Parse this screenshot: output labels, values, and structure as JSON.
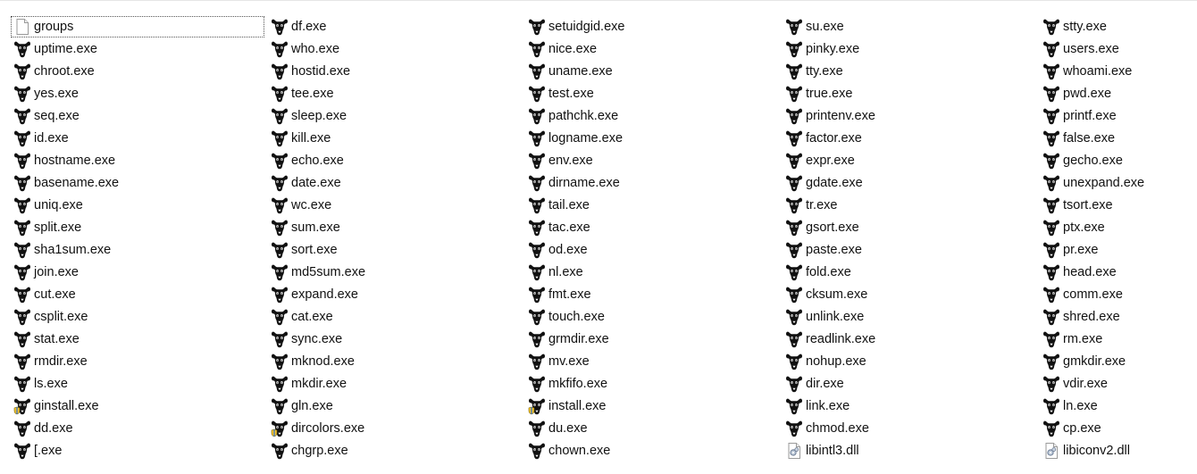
{
  "columns": [
    {
      "items": [
        {
          "name": "groups",
          "icon": "blank-file-icon",
          "focused": true
        },
        {
          "name": "uptime.exe",
          "icon": "gnu-exe-icon"
        },
        {
          "name": "chroot.exe",
          "icon": "gnu-exe-icon"
        },
        {
          "name": "yes.exe",
          "icon": "gnu-exe-icon"
        },
        {
          "name": "seq.exe",
          "icon": "gnu-exe-icon"
        },
        {
          "name": "id.exe",
          "icon": "gnu-exe-icon"
        },
        {
          "name": "hostname.exe",
          "icon": "gnu-exe-icon"
        },
        {
          "name": "basename.exe",
          "icon": "gnu-exe-icon"
        },
        {
          "name": "uniq.exe",
          "icon": "gnu-exe-icon"
        },
        {
          "name": "split.exe",
          "icon": "gnu-exe-icon"
        },
        {
          "name": "sha1sum.exe",
          "icon": "gnu-exe-icon"
        },
        {
          "name": "join.exe",
          "icon": "gnu-exe-icon"
        },
        {
          "name": "cut.exe",
          "icon": "gnu-exe-icon"
        },
        {
          "name": "csplit.exe",
          "icon": "gnu-exe-icon"
        },
        {
          "name": "stat.exe",
          "icon": "gnu-exe-icon"
        },
        {
          "name": "rmdir.exe",
          "icon": "gnu-exe-icon"
        },
        {
          "name": "ls.exe",
          "icon": "gnu-exe-icon"
        },
        {
          "name": "ginstall.exe",
          "icon": "gnu-exe-shield-icon"
        },
        {
          "name": "dd.exe",
          "icon": "gnu-exe-icon"
        },
        {
          "name": "[.exe",
          "icon": "gnu-exe-icon"
        }
      ]
    },
    {
      "items": [
        {
          "name": "df.exe",
          "icon": "gnu-exe-icon"
        },
        {
          "name": "who.exe",
          "icon": "gnu-exe-icon"
        },
        {
          "name": "hostid.exe",
          "icon": "gnu-exe-icon"
        },
        {
          "name": "tee.exe",
          "icon": "gnu-exe-icon"
        },
        {
          "name": "sleep.exe",
          "icon": "gnu-exe-icon"
        },
        {
          "name": "kill.exe",
          "icon": "gnu-exe-icon"
        },
        {
          "name": "echo.exe",
          "icon": "gnu-exe-icon"
        },
        {
          "name": "date.exe",
          "icon": "gnu-exe-icon"
        },
        {
          "name": "wc.exe",
          "icon": "gnu-exe-icon"
        },
        {
          "name": "sum.exe",
          "icon": "gnu-exe-icon"
        },
        {
          "name": "sort.exe",
          "icon": "gnu-exe-icon"
        },
        {
          "name": "md5sum.exe",
          "icon": "gnu-exe-icon"
        },
        {
          "name": "expand.exe",
          "icon": "gnu-exe-icon"
        },
        {
          "name": "cat.exe",
          "icon": "gnu-exe-icon"
        },
        {
          "name": "sync.exe",
          "icon": "gnu-exe-icon"
        },
        {
          "name": "mknod.exe",
          "icon": "gnu-exe-icon"
        },
        {
          "name": "mkdir.exe",
          "icon": "gnu-exe-icon"
        },
        {
          "name": "gln.exe",
          "icon": "gnu-exe-icon"
        },
        {
          "name": "dircolors.exe",
          "icon": "gnu-exe-shield-icon"
        },
        {
          "name": "chgrp.exe",
          "icon": "gnu-exe-icon"
        }
      ]
    },
    {
      "items": [
        {
          "name": "setuidgid.exe",
          "icon": "gnu-exe-icon"
        },
        {
          "name": "nice.exe",
          "icon": "gnu-exe-icon"
        },
        {
          "name": "uname.exe",
          "icon": "gnu-exe-icon"
        },
        {
          "name": "test.exe",
          "icon": "gnu-exe-icon"
        },
        {
          "name": "pathchk.exe",
          "icon": "gnu-exe-icon"
        },
        {
          "name": "logname.exe",
          "icon": "gnu-exe-icon"
        },
        {
          "name": "env.exe",
          "icon": "gnu-exe-icon"
        },
        {
          "name": "dirname.exe",
          "icon": "gnu-exe-icon"
        },
        {
          "name": "tail.exe",
          "icon": "gnu-exe-icon"
        },
        {
          "name": "tac.exe",
          "icon": "gnu-exe-icon"
        },
        {
          "name": "od.exe",
          "icon": "gnu-exe-icon"
        },
        {
          "name": "nl.exe",
          "icon": "gnu-exe-icon"
        },
        {
          "name": "fmt.exe",
          "icon": "gnu-exe-icon"
        },
        {
          "name": "touch.exe",
          "icon": "gnu-exe-icon"
        },
        {
          "name": "grmdir.exe",
          "icon": "gnu-exe-icon"
        },
        {
          "name": "mv.exe",
          "icon": "gnu-exe-icon"
        },
        {
          "name": "mkfifo.exe",
          "icon": "gnu-exe-icon"
        },
        {
          "name": "install.exe",
          "icon": "gnu-exe-shield-icon"
        },
        {
          "name": "du.exe",
          "icon": "gnu-exe-icon"
        },
        {
          "name": "chown.exe",
          "icon": "gnu-exe-icon"
        }
      ]
    },
    {
      "items": [
        {
          "name": "su.exe",
          "icon": "gnu-exe-icon"
        },
        {
          "name": "pinky.exe",
          "icon": "gnu-exe-icon"
        },
        {
          "name": "tty.exe",
          "icon": "gnu-exe-icon"
        },
        {
          "name": "true.exe",
          "icon": "gnu-exe-icon"
        },
        {
          "name": "printenv.exe",
          "icon": "gnu-exe-icon"
        },
        {
          "name": "factor.exe",
          "icon": "gnu-exe-icon"
        },
        {
          "name": "expr.exe",
          "icon": "gnu-exe-icon"
        },
        {
          "name": "gdate.exe",
          "icon": "gnu-exe-icon"
        },
        {
          "name": "tr.exe",
          "icon": "gnu-exe-icon"
        },
        {
          "name": "gsort.exe",
          "icon": "gnu-exe-icon"
        },
        {
          "name": "paste.exe",
          "icon": "gnu-exe-icon"
        },
        {
          "name": "fold.exe",
          "icon": "gnu-exe-icon"
        },
        {
          "name": "cksum.exe",
          "icon": "gnu-exe-icon"
        },
        {
          "name": "unlink.exe",
          "icon": "gnu-exe-icon"
        },
        {
          "name": "readlink.exe",
          "icon": "gnu-exe-icon"
        },
        {
          "name": "nohup.exe",
          "icon": "gnu-exe-icon"
        },
        {
          "name": "dir.exe",
          "icon": "gnu-exe-icon"
        },
        {
          "name": "link.exe",
          "icon": "gnu-exe-icon"
        },
        {
          "name": "chmod.exe",
          "icon": "gnu-exe-icon"
        },
        {
          "name": "libintl3.dll",
          "icon": "dll-file-icon"
        }
      ]
    },
    {
      "items": [
        {
          "name": "stty.exe",
          "icon": "gnu-exe-icon"
        },
        {
          "name": "users.exe",
          "icon": "gnu-exe-icon"
        },
        {
          "name": "whoami.exe",
          "icon": "gnu-exe-icon"
        },
        {
          "name": "pwd.exe",
          "icon": "gnu-exe-icon"
        },
        {
          "name": "printf.exe",
          "icon": "gnu-exe-icon"
        },
        {
          "name": "false.exe",
          "icon": "gnu-exe-icon"
        },
        {
          "name": "gecho.exe",
          "icon": "gnu-exe-icon"
        },
        {
          "name": "unexpand.exe",
          "icon": "gnu-exe-icon"
        },
        {
          "name": "tsort.exe",
          "icon": "gnu-exe-icon"
        },
        {
          "name": "ptx.exe",
          "icon": "gnu-exe-icon"
        },
        {
          "name": "pr.exe",
          "icon": "gnu-exe-icon"
        },
        {
          "name": "head.exe",
          "icon": "gnu-exe-icon"
        },
        {
          "name": "comm.exe",
          "icon": "gnu-exe-icon"
        },
        {
          "name": "shred.exe",
          "icon": "gnu-exe-icon"
        },
        {
          "name": "rm.exe",
          "icon": "gnu-exe-icon"
        },
        {
          "name": "gmkdir.exe",
          "icon": "gnu-exe-icon"
        },
        {
          "name": "vdir.exe",
          "icon": "gnu-exe-icon"
        },
        {
          "name": "ln.exe",
          "icon": "gnu-exe-icon"
        },
        {
          "name": "cp.exe",
          "icon": "gnu-exe-icon"
        },
        {
          "name": "libiconv2.dll",
          "icon": "dll-file-icon"
        }
      ]
    }
  ]
}
